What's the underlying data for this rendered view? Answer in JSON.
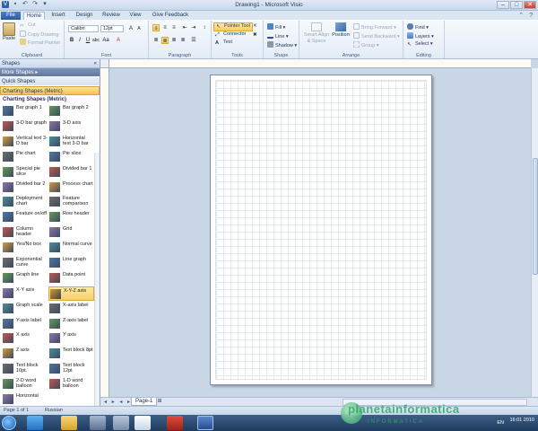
{
  "window": {
    "title": "Drawing1 - Microsoft Visio"
  },
  "tabs": [
    "File",
    "Home",
    "Insert",
    "Design",
    "Review",
    "View",
    "Give Feedback"
  ],
  "active_tab": "Home",
  "ribbon": {
    "clipboard": {
      "paste": "Paste",
      "cut": "Cut",
      "copy": "Copy Drawing",
      "format_painter": "Format Painter",
      "label": "Clipboard"
    },
    "font": {
      "font_name": "Calibri",
      "font_size": "12pt",
      "label": "Font"
    },
    "paragraph": {
      "label": "Paragraph"
    },
    "tools": {
      "pointer": "Pointer Tool",
      "connector": "Connector",
      "text": "Text",
      "label": "Tools"
    },
    "shape": {
      "fill": "Fill",
      "line": "Line",
      "shadow": "Shadow",
      "label": "Shape"
    },
    "arrange": {
      "smart_align": "Smart Align & Space",
      "position": "Position",
      "bring_forward": "Bring Forward",
      "send_backward": "Send Backward",
      "group": "Group",
      "label": "Arrange"
    },
    "editing": {
      "find": "Find",
      "layers": "Layers",
      "select": "Select",
      "label": "Editing"
    }
  },
  "shapes_pane": {
    "header": "Shapes",
    "more": "More Shapes",
    "quick": "Quick Shapes",
    "stencil": "Charting Shapes (Metric)",
    "stencil_title": "Charting Shapes (Metric)",
    "items": [
      [
        "Bar graph 1",
        "Bar graph 2"
      ],
      [
        "3-D bar graph",
        "3-D axis"
      ],
      [
        "Vertical text 3-D bar",
        "Horizontal text 3-D bar"
      ],
      [
        "Pie chart",
        "Pie slice"
      ],
      [
        "Special pie slice",
        "Divided bar 1"
      ],
      [
        "Divided bar 2",
        "Process chart"
      ],
      [
        "Deployment chart",
        "Feature comparison"
      ],
      [
        "Feature on/off",
        "Row header"
      ],
      [
        "Column header",
        "Grid"
      ],
      [
        "Yes/No box",
        "Normal curve"
      ],
      [
        "Exponential curve",
        "Line graph"
      ],
      [
        "Graph line",
        "Data point"
      ],
      [
        "X-Y axis",
        "X-Y-Z axis"
      ],
      [
        "Graph scale",
        "X-axis label"
      ],
      [
        "Y-axis label",
        "Z-axis label"
      ],
      [
        "X axis",
        "Y axis"
      ],
      [
        "Z axis",
        "Text block 8pt"
      ],
      [
        "Text block 10pt.",
        "Text block 12pt"
      ],
      [
        "2-D word balloon",
        "1-D word balloon"
      ],
      [
        "Horizontal",
        ""
      ]
    ],
    "selected_item": "X-Y-Z axis"
  },
  "canvas": {
    "page_tab": "Page-1"
  },
  "status": {
    "page": "Page 1 of 1",
    "language": "Russian"
  },
  "taskbar": {
    "lang": "EN",
    "time": "16:01 2010"
  },
  "watermark": {
    "main": "planetainformatica",
    "sub": "INFORMATICA"
  }
}
